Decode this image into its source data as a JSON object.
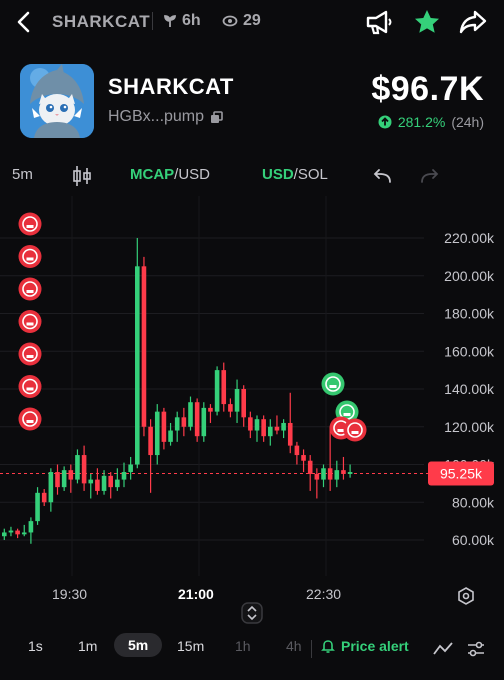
{
  "header": {
    "title": "SHARKCAT",
    "age": "6h",
    "views": "29",
    "icons": [
      "back-icon",
      "horn-icon",
      "star-icon",
      "share-icon"
    ]
  },
  "token": {
    "name": "SHARKCAT",
    "address": "HGBx...pump",
    "price": "$96.7K",
    "change": "281.2%",
    "change_period": "(24h)"
  },
  "toolbar": {
    "interval": "5m",
    "mcap_a": "MCAP",
    "mcap_b": "/USD",
    "cur_a": "USD",
    "cur_b": "/SOL"
  },
  "chart_data": {
    "type": "candlestick",
    "y_ticks": [
      "220.00k",
      "200.00k",
      "180.00k",
      "160.00k",
      "140.00k",
      "120.00k",
      "100.00k",
      "80.00k",
      "60.00k"
    ],
    "ylim": [
      50000,
      230000
    ],
    "current_price_label": "95.25k",
    "current_price": 95250,
    "x_ticks": [
      "19:30",
      "21:00",
      "22:30"
    ],
    "colors": {
      "up": "#35d07a",
      "down": "#ff3b4a"
    },
    "candles": [
      [
        62,
        64,
        60,
        66
      ],
      [
        64,
        65,
        62,
        67
      ],
      [
        65,
        63,
        61,
        66
      ],
      [
        63,
        64,
        62,
        68
      ],
      [
        64,
        70,
        58,
        72
      ],
      [
        70,
        85,
        68,
        88
      ],
      [
        85,
        80,
        78,
        87
      ],
      [
        80,
        96,
        75,
        98
      ],
      [
        96,
        88,
        84,
        100
      ],
      [
        88,
        97,
        86,
        99
      ],
      [
        97,
        92,
        85,
        100
      ],
      [
        92,
        105,
        90,
        108
      ],
      [
        105,
        90,
        86,
        110
      ],
      [
        90,
        92,
        82,
        95
      ],
      [
        92,
        86,
        84,
        98
      ],
      [
        86,
        94,
        84,
        97
      ],
      [
        94,
        88,
        82,
        96
      ],
      [
        88,
        92,
        86,
        98
      ],
      [
        92,
        96,
        88,
        101
      ],
      [
        96,
        100,
        92,
        104
      ],
      [
        100,
        205,
        98,
        220
      ],
      [
        205,
        120,
        115,
        210
      ],
      [
        120,
        105,
        85,
        124
      ],
      [
        105,
        128,
        100,
        132
      ],
      [
        128,
        112,
        108,
        130
      ],
      [
        112,
        118,
        110,
        122
      ],
      [
        118,
        125,
        112,
        128
      ],
      [
        125,
        120,
        115,
        130
      ],
      [
        120,
        133,
        118,
        136
      ],
      [
        133,
        115,
        112,
        135
      ],
      [
        115,
        130,
        112,
        133
      ],
      [
        130,
        128,
        122,
        132
      ],
      [
        128,
        150,
        126,
        152
      ],
      [
        150,
        132,
        128,
        154
      ],
      [
        132,
        128,
        125,
        135
      ],
      [
        128,
        140,
        122,
        145
      ],
      [
        140,
        125,
        120,
        142
      ],
      [
        125,
        118,
        114,
        128
      ],
      [
        118,
        124,
        112,
        126
      ],
      [
        124,
        115,
        112,
        126
      ],
      [
        115,
        120,
        110,
        124
      ],
      [
        120,
        118,
        116,
        126
      ],
      [
        118,
        122,
        114,
        124
      ],
      [
        122,
        110,
        106,
        138
      ],
      [
        110,
        105,
        100,
        112
      ],
      [
        105,
        102,
        96,
        108
      ],
      [
        102,
        95,
        86,
        105
      ],
      [
        95,
        92,
        82,
        98
      ],
      [
        92,
        98,
        88,
        100
      ],
      [
        98,
        92,
        86,
        120
      ],
      [
        92,
        97,
        88,
        102
      ],
      [
        97,
        95,
        92,
        104
      ],
      [
        95,
        96,
        93,
        100
      ]
    ]
  },
  "markers": {
    "left_count": 7,
    "right": [
      "green",
      "green",
      "red",
      "red"
    ]
  },
  "bottom": {
    "timeframes": [
      "1s",
      "1m",
      "5m",
      "15m",
      "1h",
      "4h"
    ],
    "active": "5m",
    "price_alert": "Price alert"
  }
}
